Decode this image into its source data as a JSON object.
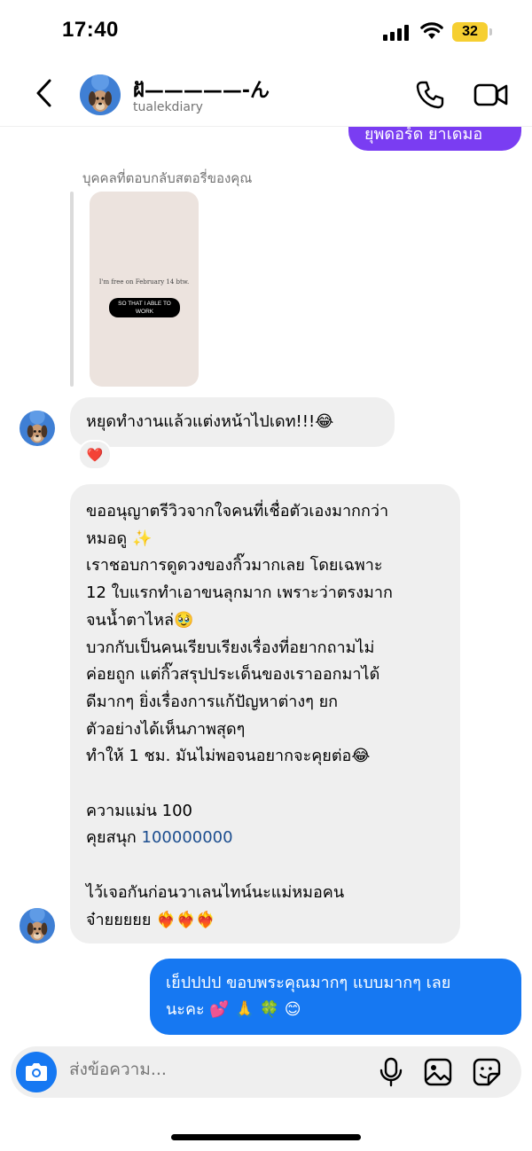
{
  "status_bar": {
    "time": "17:40",
    "battery": "32"
  },
  "header": {
    "name": "ฝั—————-ん",
    "username": "tualekdiary"
  },
  "colors": {
    "outgoing_bubble": "#1678f2",
    "incoming_bubble": "#efefef",
    "battery": "#f6cf31",
    "previous_bubble": "#7a3df2",
    "reaction_heart": "#e8233e"
  },
  "story_reply": {
    "caption": "บุคคลที่ตอบกลับสตอรี่ของคุณ",
    "story_text": "I'm free on February 14 btw.",
    "story_pill": "SO THAT I ABLE TO WORK"
  },
  "messages": {
    "previous_outgoing_partial": "ยุพดอร์ด ยาเดมอ",
    "reply_text": "หยุดทำงานแล้วแต่งหน้าไปเดท!!!😂",
    "reply_reaction": "❤️",
    "review_lines": [
      "ขออนุญาตรีวิวจากใจคนที่เชื่อตัวเองมากกว่า",
      "หมอดู ✨",
      "เราชอบการดูดวงของกิ๊วมากเลย โดยเฉพาะ",
      "12 ใบแรกทำเอาขนลุกมาก เพราะว่าตรงมาก",
      "จนน้ำตาไหล่🥹",
      "บวกกับเป็นคนเรียบเรียงเรื่องที่อยากถามไม่",
      "ค่อยถูก แต่กิ๊วสรุปประเด็นของเราออกมาได้",
      "ดีมากๆ ยิ่งเรื่องการแก้ปัญหาต่างๆ ยก",
      "ตัวอย่างได้เห็นภาพสุดๆ",
      "ทำให้ 1 ชม. มันไม่พอจนอยากจะคุยต่อ😂",
      "",
      "ความแม่น 100",
      "",
      "",
      "ไว้เจอกันก่อนวาเลนไทน์นะแม่หมอคน",
      "จ๋ายยยยย ❤️‍🔥❤️‍🔥❤️‍🔥"
    ],
    "fun_label": "คุยสนุก",
    "fun_value": "100000000",
    "outgoing_lines": [
      "เย็ปปปป ขอบพระคุณมากๆ แบบมากๆ เลย",
      "นะคะ 💕 🙏 🍀 😊"
    ]
  },
  "composer": {
    "placeholder": "ส่งข้อความ..."
  }
}
